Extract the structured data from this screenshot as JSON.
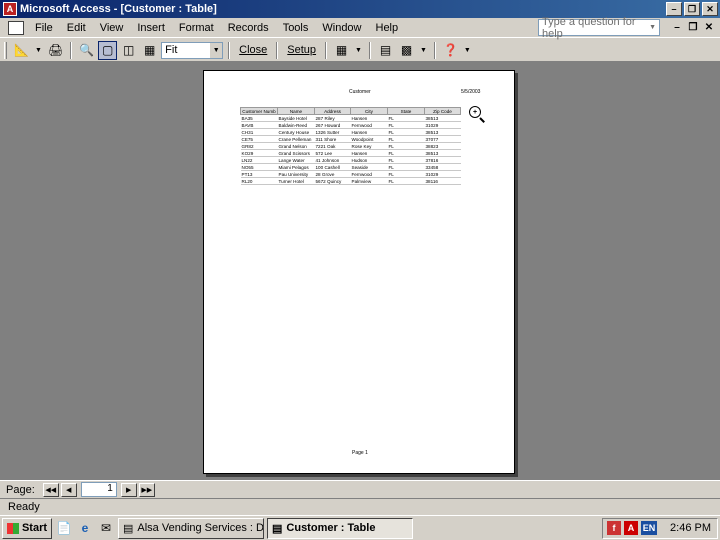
{
  "window": {
    "title": "Microsoft Access - [Customer : Table]"
  },
  "menu": {
    "items": [
      "File",
      "Edit",
      "View",
      "Insert",
      "Format",
      "Records",
      "Tools",
      "Window",
      "Help"
    ],
    "help_placeholder": "Type a question for help"
  },
  "toolbar": {
    "zoom_value": "Fit",
    "close_label": "Close",
    "setup_label": "Setup"
  },
  "report": {
    "title": "Customer",
    "date": "5/5/2003",
    "columns": [
      "Customer Numb",
      "Name",
      "Address",
      "City",
      "State",
      "Zip Code"
    ],
    "rows": [
      [
        "BA35",
        "Bayside Hotel",
        "287 Riley",
        "Hansen",
        "FL",
        "38513"
      ],
      [
        "BAVB",
        "Baldwin-Reed",
        "267 Howard",
        "Fernwood",
        "FL",
        "31029"
      ],
      [
        "CH31",
        "Century House",
        "1326 Sutter",
        "Hansen",
        "FL",
        "38513"
      ],
      [
        "CE75",
        "Crane Pelleman",
        "311 Shore",
        "Woodpoint",
        "FL",
        "37077"
      ],
      [
        "GR82",
        "Grand Nelson",
        "7221 Oak",
        "Rose Key",
        "FL",
        "38823"
      ],
      [
        "KO29",
        "Grand Scissors",
        "572 Lee",
        "Hansen",
        "FL",
        "38513"
      ],
      [
        "LN22",
        "Lange Water",
        "41 Johnson",
        "Hudson",
        "FL",
        "37816"
      ],
      [
        "NO55",
        "Miami Pelagos",
        "100 Cashell",
        "Seaside",
        "FL",
        "33458"
      ],
      [
        "PT13",
        "Pau University",
        "28 Grove",
        "Fernwood",
        "FL",
        "31029"
      ],
      [
        "RL20",
        "Turner Hotel",
        "5672 Quincy",
        "Palmview",
        "FL",
        "38116"
      ]
    ],
    "footer": "Page 1"
  },
  "navigation": {
    "page_label": "Page:",
    "page_value": "1"
  },
  "status": {
    "text": "Ready"
  },
  "taskbar": {
    "start_label": "Start",
    "tasks": [
      "Alsa Vending Services : D...",
      "Customer : Table"
    ],
    "tray_lang": "EN",
    "clock": "2:46 PM"
  },
  "colors": {
    "titlebar": "#0a246a",
    "workspace": "#808080",
    "chrome": "#d4d0c8"
  }
}
